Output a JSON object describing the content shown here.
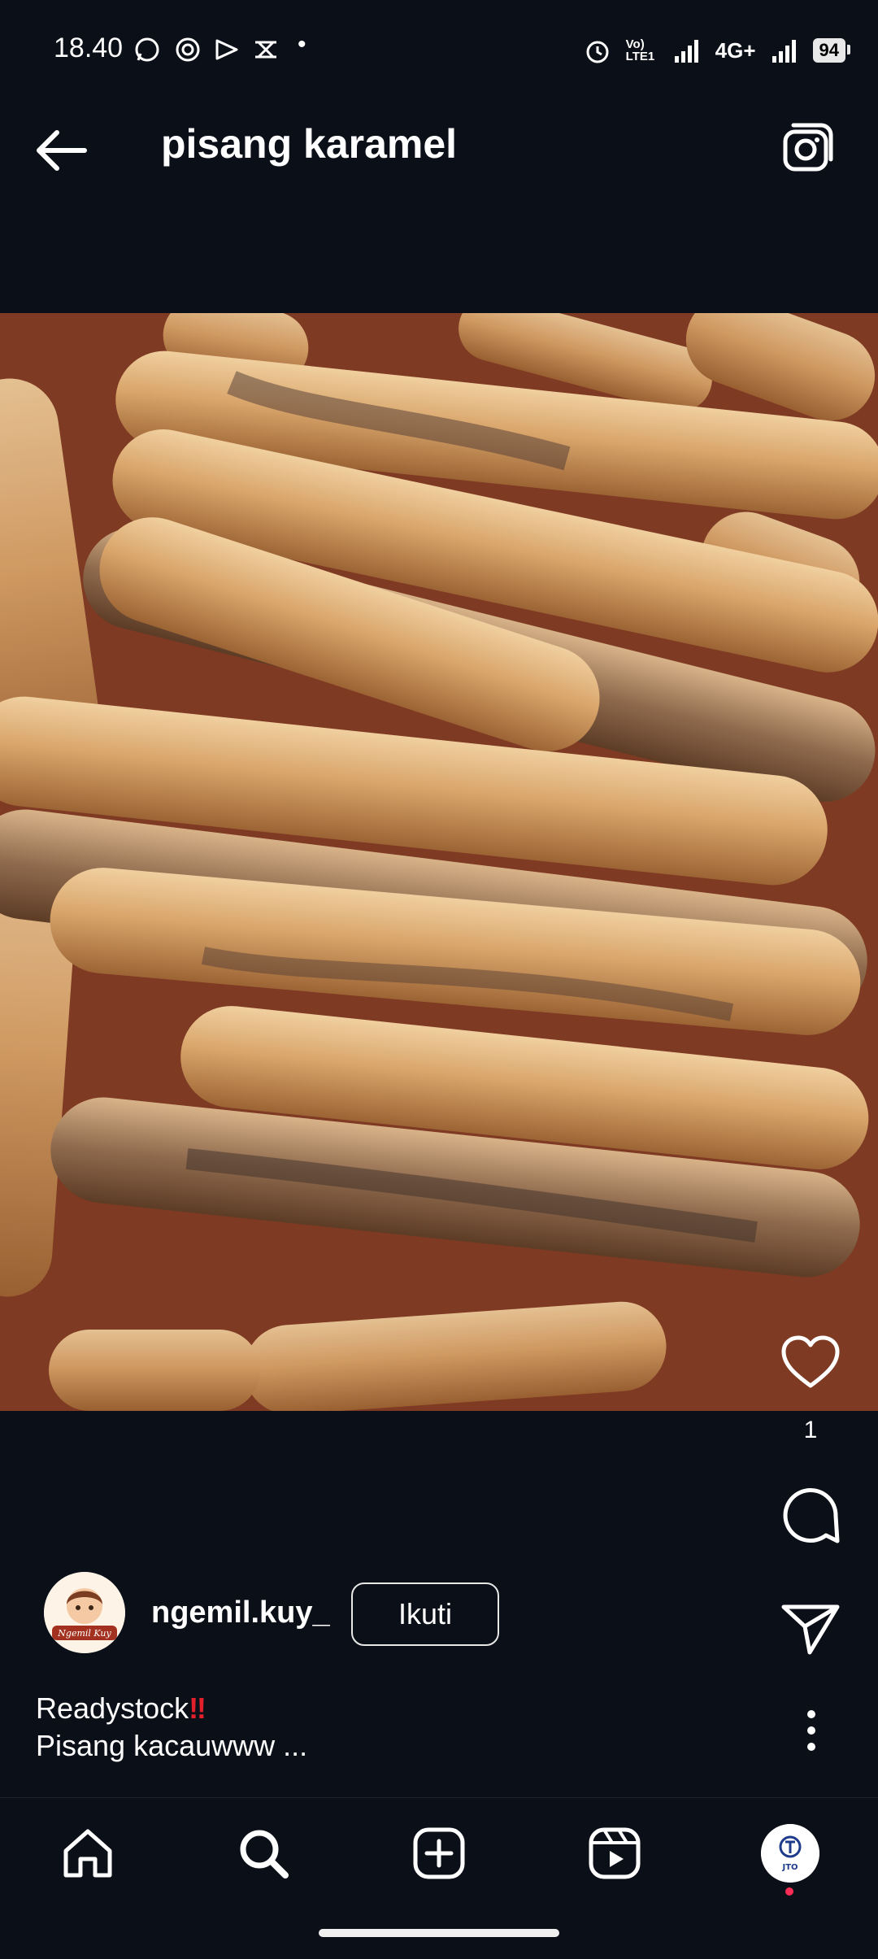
{
  "status_bar": {
    "time": "18.40",
    "network_label": "4G+",
    "network_badge": "Vo) LTE1",
    "battery": "94",
    "dot": "•"
  },
  "header": {
    "title": "pisang karamel",
    "back_icon": "arrow-left-icon",
    "camera_icon": "camera-icon"
  },
  "post": {
    "image_subject": "fried banana spring roll sticks (pisang karamel)",
    "like_count": "1",
    "username": "ngemil.kuy_",
    "follow_label": "Ikuti",
    "caption_line1": "Readystock",
    "caption_emoji": "‼",
    "caption_line2": "Pisang kacauwww ...",
    "avatar_text": "Ngemil Kuy"
  },
  "bottom_nav": {
    "items": [
      "home-icon",
      "search-icon",
      "add-icon",
      "reels-icon",
      "profile-avatar"
    ],
    "profile_text": "JTO"
  },
  "colors": {
    "background": "#0b0f17",
    "accent_red": "#e2202c",
    "notification_dot": "#ff2d55"
  }
}
